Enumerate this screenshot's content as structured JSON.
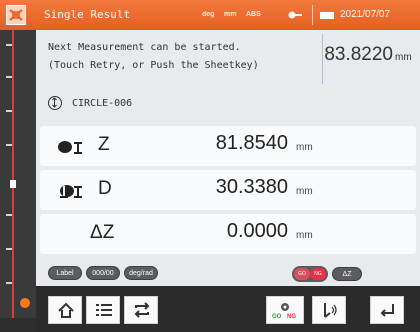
{
  "titlebar": {
    "title": "Single Result",
    "indicators": [
      "deg",
      "mm",
      "ABS"
    ],
    "date": "2021/07/07"
  },
  "message": {
    "line1": "Next Measurement can be started.",
    "line2": "(Touch Retry, or Push the Sheetkey)"
  },
  "result": {
    "value": "83.8220",
    "unit": "mm"
  },
  "feature": {
    "label": "CIRCLE-006"
  },
  "measurements": [
    {
      "name": "Z",
      "value": "81.8540",
      "unit": "mm",
      "icon": "z-axis-icon"
    },
    {
      "name": "D",
      "value": "30.3380",
      "unit": "mm",
      "icon": "diameter-icon"
    },
    {
      "name": "ΔZ",
      "value": "0.0000",
      "unit": "mm",
      "icon": ""
    }
  ],
  "options": {
    "label": "Label",
    "counter": "000/00",
    "angle": "deg/rad",
    "go": "GO",
    "ng": "NG",
    "delta": "ΔZ"
  },
  "colors": {
    "accent": "#e96a2e",
    "go_ng": "#e8304a"
  },
  "bottom_nav": {
    "icons": [
      "home-icon",
      "list-icon",
      "repeat-icon",
      "go-ng-settings-icon",
      "probe-icon",
      "back-icon"
    ],
    "go_label": "GO",
    "ng_label": "NG"
  }
}
